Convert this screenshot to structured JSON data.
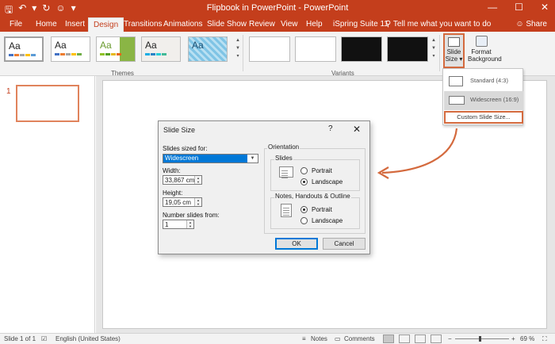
{
  "window": {
    "title": "Flipbook in PowerPoint  -  PowerPoint",
    "minimize": "—",
    "restore": "☐",
    "close": "✕"
  },
  "qat": {
    "save": "🖫",
    "undo": "↶",
    "undo_arrow": "▾",
    "redo": "↻",
    "touch": "☺",
    "more": "▾"
  },
  "tabs": [
    {
      "label": "File"
    },
    {
      "label": "Home"
    },
    {
      "label": "Insert"
    },
    {
      "label": "Design"
    },
    {
      "label": "Transitions"
    },
    {
      "label": "Animations"
    },
    {
      "label": "Slide Show"
    },
    {
      "label": "Review"
    },
    {
      "label": "View"
    },
    {
      "label": "Help"
    },
    {
      "label": "iSpring Suite 11"
    }
  ],
  "active_tab": "Design",
  "tell_me": "Tell me what you want to do",
  "share": "Share",
  "ribbon": {
    "theme_text": "Aa",
    "gallery_scroll": {
      "up": "▲",
      "down": "▼",
      "more": "▾"
    },
    "themes_label": "Themes",
    "variants_label": "Variants",
    "slide_size": {
      "line1": "Slide",
      "line2": "Size ▾"
    },
    "format_background": {
      "line1": "Format",
      "line2": "Background"
    }
  },
  "slide_size_menu": {
    "items": [
      {
        "label": "Standard (4:3)"
      },
      {
        "label": "Widescreen (16:9)"
      }
    ],
    "custom": "Custom Slide Size..."
  },
  "thumbnail_pane": {
    "slide_number": "1"
  },
  "dialog": {
    "title": "Slide Size",
    "help": "?",
    "close": "✕",
    "sized_for_label": "Slides sized for:",
    "sized_for_value": "Widescreen",
    "width_label": "Width:",
    "width_value": "33,867 cm",
    "height_label": "Height:",
    "height_value": "19,05 cm",
    "number_from_label": "Number slides from:",
    "number_from_value": "1",
    "orientation_label": "Orientation",
    "slides_label": "Slides",
    "notes_label": "Notes, Handouts & Outline",
    "portrait": "Portrait",
    "landscape": "Landscape",
    "ok": "OK",
    "cancel": "Cancel"
  },
  "statusbar": {
    "slide": "Slide 1 of 1",
    "language": "English (United States)",
    "notes": "Notes",
    "comments": "Comments",
    "zoom": "69 %"
  },
  "colors": {
    "accent": "#c43e1c",
    "highlight": "#d46a3e",
    "selection": "#0078d7"
  }
}
